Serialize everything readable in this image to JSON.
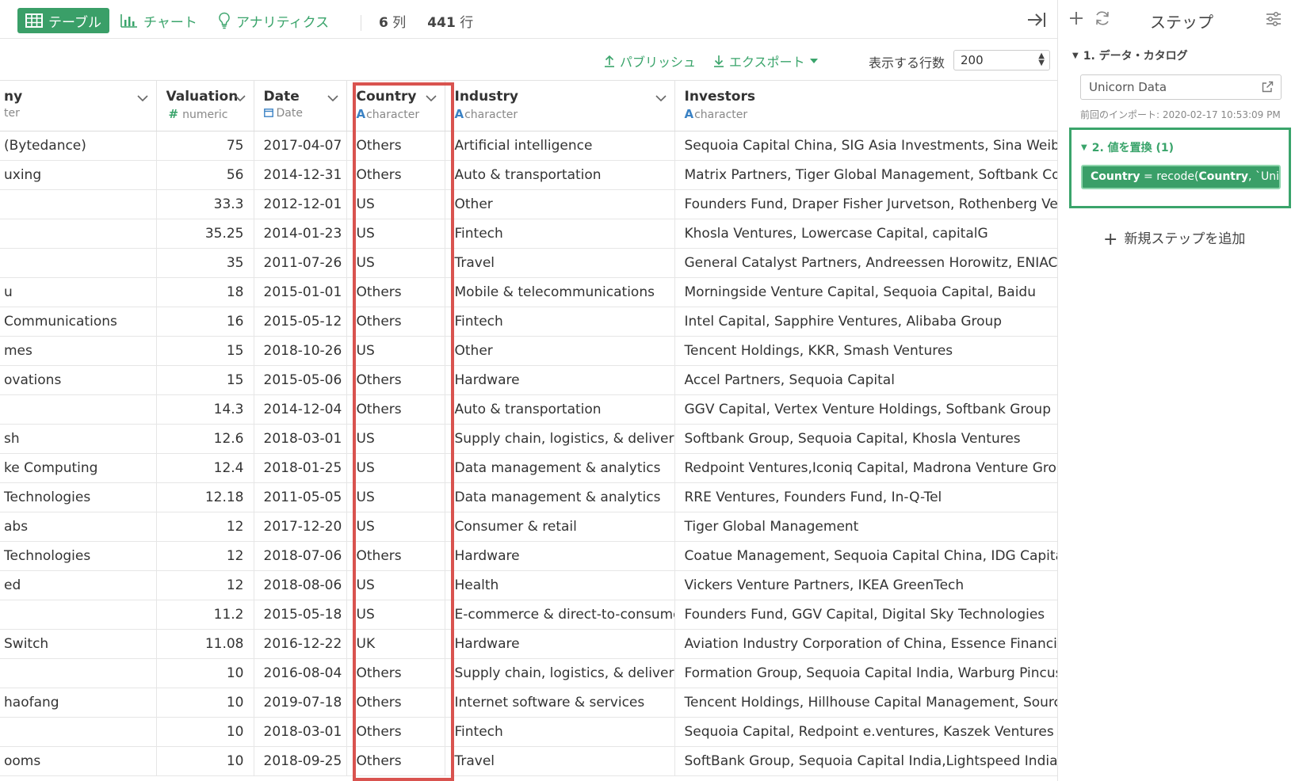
{
  "toolbar": {
    "views": [
      {
        "label": "テーブル",
        "icon": "table-icon",
        "active": true
      },
      {
        "label": "チャート",
        "icon": "bar-chart-icon",
        "active": false
      },
      {
        "label": "アナリティクス",
        "icon": "lightbulb-icon",
        "active": false
      }
    ],
    "column_count": "6",
    "column_unit": "列",
    "row_count": "441",
    "row_unit": "行"
  },
  "actions": {
    "publish": "パブリッシュ",
    "export": "エクスポート",
    "rows_label": "表示する行数",
    "rows_value": "200"
  },
  "table": {
    "columns": [
      {
        "name": "ny",
        "type": "ter",
        "type_icon": ""
      },
      {
        "name": "Valuation",
        "type": "numeric",
        "type_icon": "#"
      },
      {
        "name": "Date",
        "type": "Date",
        "type_icon": "calendar"
      },
      {
        "name": "Country",
        "type": "character",
        "type_icon": "A"
      },
      {
        "name": "Industry",
        "type": "character",
        "type_icon": "A"
      },
      {
        "name": "Investors",
        "type": "character",
        "type_icon": "A"
      }
    ],
    "rows": [
      [
        "(Bytedance)",
        "75",
        "2017-04-07",
        "Others",
        "Artificial intelligence",
        "Sequoia Capital China, SIG Asia Investments, Sina Weibo, Softbank Group"
      ],
      [
        "uxing",
        "56",
        "2014-12-31",
        "Others",
        "Auto & transportation",
        "Matrix Partners, Tiger Global Management, Softbank Corp."
      ],
      [
        "",
        "33.3",
        "2012-12-01",
        "US",
        "Other",
        "Founders Fund, Draper Fisher Jurvetson, Rothenberg Ventures"
      ],
      [
        "",
        "35.25",
        "2014-01-23",
        "US",
        "Fintech",
        "Khosla Ventures, Lowercase Capital, capitalG"
      ],
      [
        "",
        "35",
        "2011-07-26",
        "US",
        "Travel",
        "General Catalyst Partners, Andreessen Horowitz, ENIAC Ventures"
      ],
      [
        "u",
        "18",
        "2015-01-01",
        "Others",
        "Mobile & telecommunications",
        "Morningside Venture Capital, Sequoia Capital, Baidu"
      ],
      [
        "Communications",
        "16",
        "2015-05-12",
        "Others",
        "Fintech",
        "Intel Capital, Sapphire Ventures, Alibaba Group"
      ],
      [
        "mes",
        "15",
        "2018-10-26",
        "US",
        "Other",
        "Tencent Holdings, KKR, Smash Ventures"
      ],
      [
        "ovations",
        "15",
        "2015-05-06",
        "Others",
        "Hardware",
        "Accel Partners, Sequoia Capital"
      ],
      [
        "",
        "14.3",
        "2014-12-04",
        "Others",
        "Auto & transportation",
        "GGV Capital, Vertex Venture Holdings, Softbank Group"
      ],
      [
        "sh",
        "12.6",
        "2018-03-01",
        "US",
        "Supply chain, logistics, & delivery",
        "Softbank Group, Sequoia Capital, Khosla Ventures"
      ],
      [
        "ke Computing",
        "12.4",
        "2018-01-25",
        "US",
        "Data management & analytics",
        "Redpoint Ventures,Iconiq Capital, Madrona Venture Group"
      ],
      [
        "Technologies",
        "12.18",
        "2011-05-05",
        "US",
        "Data management & analytics",
        "RRE Ventures, Founders Fund, In-Q-Tel"
      ],
      [
        "abs",
        "12",
        "2017-12-20",
        "US",
        "Consumer & retail",
        "Tiger Global Management"
      ],
      [
        "Technologies",
        "12",
        "2018-07-06",
        "Others",
        "Hardware",
        "Coatue Management, Sequoia Capital China, IDG Capital"
      ],
      [
        "ed",
        "12",
        "2018-08-06",
        "US",
        "Health",
        "Vickers Venture Partners, IKEA GreenTech"
      ],
      [
        "",
        "11.2",
        "2015-05-18",
        "US",
        "E-commerce & direct-to-consumer",
        "Founders Fund, GGV Capital, Digital Sky Technologies"
      ],
      [
        "Switch",
        "11.08",
        "2016-12-22",
        "UK",
        "Hardware",
        "Aviation Industry Corporation of China, Essence Financial, Jiangsu Sunning"
      ],
      [
        "",
        "10",
        "2016-08-04",
        "Others",
        "Supply chain, logistics, & delivery",
        "Formation Group, Sequoia Capital India, Warburg Pincus"
      ],
      [
        "haofang",
        "10",
        "2019-07-18",
        "Others",
        "Internet software & services",
        "Tencent Holdings, Hillhouse Capital Management, Source Code Capital"
      ],
      [
        "",
        "10",
        "2018-03-01",
        "Others",
        "Fintech",
        "Sequoia Capital, Redpoint e.ventures, Kaszek Ventures"
      ],
      [
        "ooms",
        "10",
        "2018-09-25",
        "Others",
        "Travel",
        "SoftBank Group, Sequoia Capital India,Lightspeed India Partners"
      ]
    ]
  },
  "panel": {
    "title": "ステップ",
    "step1": {
      "title": "1. データ・カタログ",
      "source": "Unicorn Data",
      "last_import": "前回のインポート: 2020-02-17 10:53:09 PM"
    },
    "step2": {
      "title": "2. 値を置換 (1)",
      "target": "Country",
      "op": " = recode(",
      "arg": "Country",
      "rest": ", `United..."
    },
    "add_step": "新規ステップを追加"
  },
  "colors": {
    "accent": "#3a9f68",
    "highlight": "#d9534f",
    "type_blue": "#3b82c4"
  }
}
